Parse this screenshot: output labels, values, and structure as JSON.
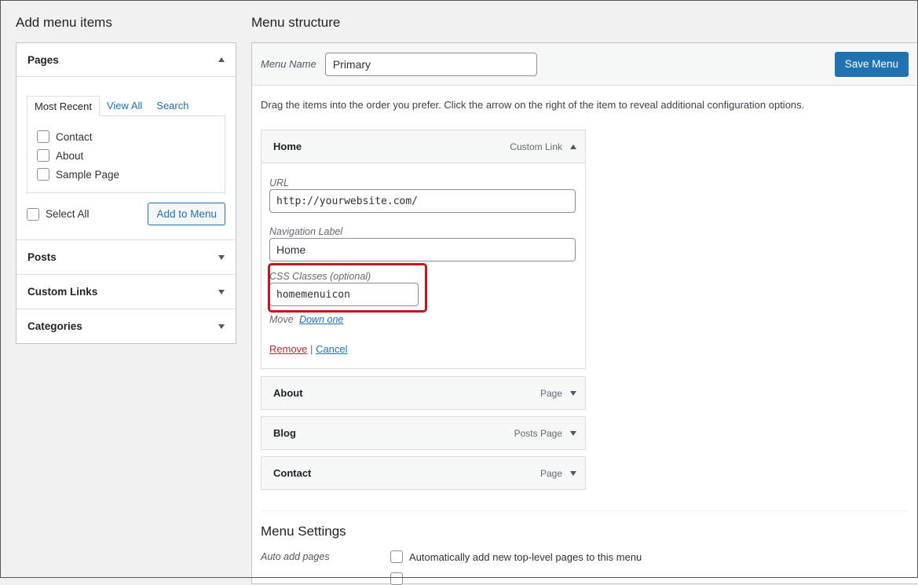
{
  "left": {
    "heading": "Add menu items",
    "pages": {
      "title": "Pages",
      "tabs": [
        "Most Recent",
        "View All",
        "Search"
      ],
      "items": [
        "Contact",
        "About",
        "Sample Page"
      ],
      "select_all": "Select All",
      "add_button": "Add to Menu"
    },
    "sections": [
      "Posts",
      "Custom Links",
      "Categories"
    ]
  },
  "right": {
    "heading": "Menu structure",
    "menu_name_label": "Menu Name",
    "menu_name_value": "Primary",
    "save_button": "Save Menu",
    "instructions": "Drag the items into the order you prefer. Click the arrow on the right of the item to reveal additional configuration options.",
    "items": [
      {
        "title": "Home",
        "type": "Custom Link",
        "url_label": "URL",
        "url_value": "http://yourwebsite.com/",
        "nav_label": "Navigation Label",
        "nav_value": "Home",
        "css_label": "CSS Classes (optional)",
        "css_value": "homemenuicon",
        "move_label": "Move",
        "move_link": "Down one",
        "remove_link": "Remove",
        "separator": "|",
        "cancel_link": "Cancel"
      },
      {
        "title": "About",
        "type": "Page"
      },
      {
        "title": "Blog",
        "type": "Posts Page"
      },
      {
        "title": "Contact",
        "type": "Page"
      }
    ],
    "settings": {
      "title": "Menu Settings",
      "auto_add_label": "Auto add pages",
      "auto_add_text": "Automatically add new top-level pages to this menu"
    }
  },
  "colors": {
    "accent": "#2271b1",
    "highlight": "#c4161c",
    "remove": "#b32d2e"
  }
}
